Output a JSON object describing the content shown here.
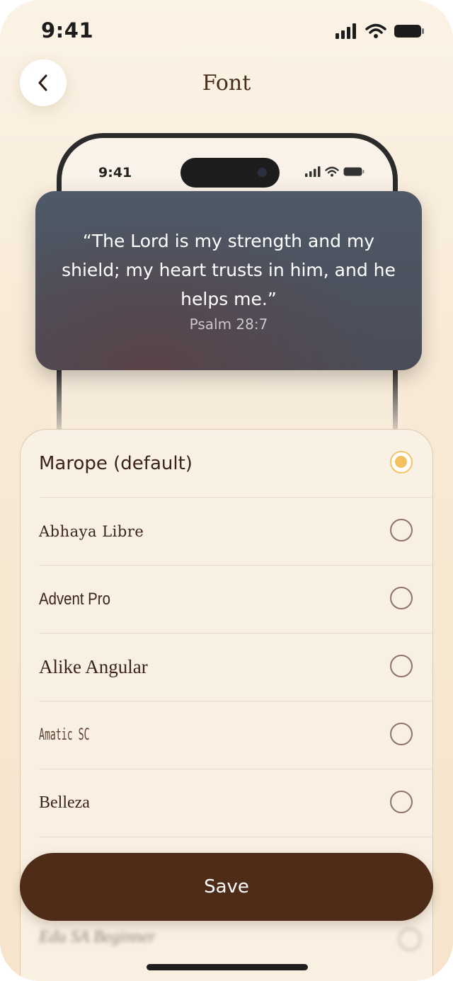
{
  "status_bar": {
    "time": "9:41"
  },
  "header": {
    "title": "Font"
  },
  "preview": {
    "time": "9:41",
    "quote": "“The Lord is my strength and my shield; my heart trusts in him, and he helps me.”",
    "reference": "Psalm 28:7"
  },
  "fonts": [
    {
      "label": "Marope (default)",
      "selected": true
    },
    {
      "label": "Abhaya Libre",
      "selected": false
    },
    {
      "label": "Advent Pro",
      "selected": false
    },
    {
      "label": "Alike Angular",
      "selected": false
    },
    {
      "label": "Amatic SC",
      "selected": false
    },
    {
      "label": "Belleza",
      "selected": false
    }
  ],
  "blurred_row": {
    "label": "Edu SA Beginner"
  },
  "save_label": "Save",
  "colors": {
    "accent": "#f4c15f",
    "button": "#4f2c18",
    "text": "#3b2416"
  }
}
